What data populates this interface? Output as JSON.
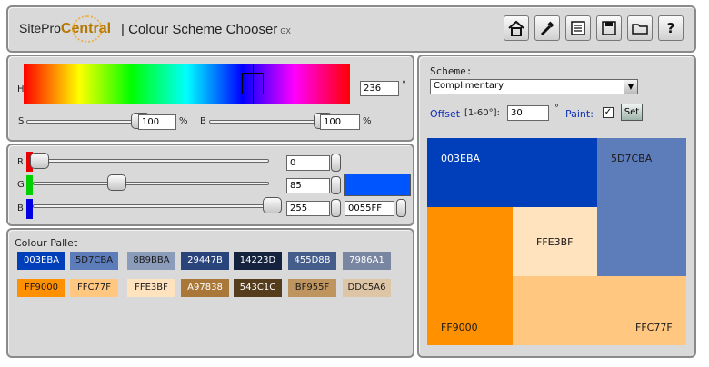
{
  "header": {
    "logo_prefix": "SitePro",
    "logo_bold": "Central",
    "separator_title": "| Colour Scheme Chooser",
    "title_suffix": "GX",
    "toolbar": [
      "home-icon",
      "eyedropper-icon",
      "document-icon",
      "save-icon",
      "folder-icon",
      "help-icon"
    ],
    "help_label": "?"
  },
  "hsb": {
    "h_label": "H",
    "hue_value": "236",
    "degree": "°",
    "s_label": "S",
    "saturation_value": "100",
    "b_label": "B",
    "brightness_value": "100",
    "percent": "%",
    "saturation_level": 1.0,
    "brightness_level": 1.0,
    "hue_level": 0.6556
  },
  "rgb": {
    "r_label": "R",
    "g_label": "G",
    "b_label": "B",
    "r_value": "0",
    "g_value": "85",
    "b_value": "255",
    "hex_value": "0055FF",
    "current_color": "#0055ff"
  },
  "pallet": {
    "title": "Colour Pallet",
    "row1": [
      {
        "hex": "003EBA",
        "color": "#003eba",
        "text": "#ffffff"
      },
      {
        "hex": "5D7CBA",
        "color": "#5d7cba",
        "text": "#1a1a1a"
      },
      {
        "hex": "8B9BBA",
        "color": "#8b9bba",
        "text": "#1a1a1a"
      },
      {
        "hex": "29447B",
        "color": "#29447b",
        "text": "#ffffff"
      },
      {
        "hex": "14223D",
        "color": "#14223d",
        "text": "#ffffff"
      },
      {
        "hex": "455D8B",
        "color": "#455d8b",
        "text": "#ffffff"
      },
      {
        "hex": "7986A1",
        "color": "#7986a1",
        "text": "#ffffff"
      }
    ],
    "row2": [
      {
        "hex": "FF9000",
        "color": "#ff9000",
        "text": "#1a1a1a"
      },
      {
        "hex": "FFC77F",
        "color": "#ffc77f",
        "text": "#1a1a1a"
      },
      {
        "hex": "FFE3BF",
        "color": "#ffe3bf",
        "text": "#1a1a1a"
      },
      {
        "hex": "A97838",
        "color": "#a97838",
        "text": "#ffffff"
      },
      {
        "hex": "543C1C",
        "color": "#543c1c",
        "text": "#ffffff"
      },
      {
        "hex": "BF955F",
        "color": "#bf955f",
        "text": "#1a1a1a"
      },
      {
        "hex": "DDC5A6",
        "color": "#ddc5a6",
        "text": "#1a1a1a"
      }
    ]
  },
  "scheme": {
    "label": "Scheme:",
    "selected": "Complimentary",
    "offset_label": "Offset",
    "offset_range": "[1-60°]:",
    "offset_value": "30",
    "degree": "°",
    "paint_label": "Paint:",
    "paint_checked": "✓",
    "set_label": "Set",
    "preview": [
      {
        "hex": "003EBA",
        "color": "#003eba",
        "text": "#ffffff"
      },
      {
        "hex": "5D7CBA",
        "color": "#5d7cba",
        "text": "#1a1a1a"
      },
      {
        "hex": "FFE3BF",
        "color": "#ffe3bf",
        "text": "#1a1a1a"
      },
      {
        "hex": "FF9000",
        "color": "#ff9000",
        "text": "#1a1a1a"
      },
      {
        "hex": "FFC77F",
        "color": "#ffc77f",
        "text": "#1a1a1a"
      }
    ]
  }
}
